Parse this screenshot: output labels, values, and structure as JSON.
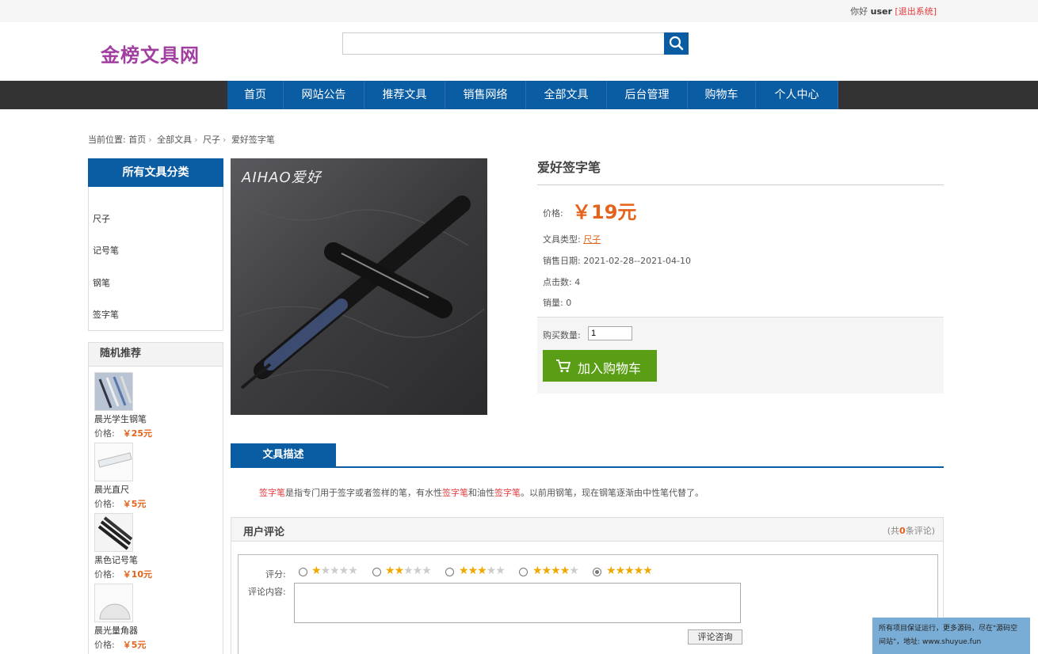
{
  "topbar": {
    "greeting": "你好",
    "username": "user",
    "logout": "[退出系统]"
  },
  "logo": "金榜文具网",
  "search": {
    "value": "",
    "placeholder": ""
  },
  "nav": [
    "首页",
    "网站公告",
    "推荐文具",
    "销售网络",
    "全部文具",
    "后台管理",
    "购物车",
    "个人中心"
  ],
  "breadcrumb": {
    "prefix": "当前位置:",
    "items": [
      "首页",
      "全部文具",
      "尺子",
      "爱好签字笔"
    ]
  },
  "categories": {
    "title": "所有文具分类",
    "items": [
      "尺子",
      "记号笔",
      "钢笔",
      "签字笔"
    ]
  },
  "recommend": {
    "title": "随机推荐",
    "price_label": "价格:",
    "items": [
      {
        "name": "晨光学生钢笔",
        "price": "￥25元"
      },
      {
        "name": "晨光直尺",
        "price": "￥5元"
      },
      {
        "name": "黑色记号笔",
        "price": "￥10元"
      },
      {
        "name": "晨光量角器",
        "price": "￥5元"
      }
    ]
  },
  "product": {
    "image_text": "AIHAO爱好",
    "title": "爱好签字笔",
    "price_label": "价格:",
    "price": "￥19元",
    "type_label": "文具类型:",
    "type": "尺子",
    "date_label": "销售日期:",
    "date": "2021-02-28--2021-04-10",
    "clicks_label": "点击数:",
    "clicks": "4",
    "sales_label": "销量:",
    "sales": "0",
    "qty_label": "购买数量:",
    "qty": "1",
    "cart_button": "加入购物车"
  },
  "description": {
    "tab": "文具描述",
    "parts": [
      "签字笔",
      "是指专门用于签字或者签样的笔，有水性",
      "签字笔",
      "和油性",
      "签字笔",
      "。以前用钢笔，现在钢笔逐渐由中性笔代替了。"
    ]
  },
  "comments": {
    "title": "用户评论",
    "count_prefix": "(共",
    "count": "0",
    "count_suffix": "条评论)",
    "score_label": "评分:",
    "scores": [
      1,
      2,
      3,
      4,
      5
    ],
    "selected_score": 5,
    "content_label": "评论内容:",
    "content_value": "",
    "submit": "评论咨询"
  },
  "promo": "所有项目保证运行，更多源码，尽在\"源码空间站\"，地址: www.shuyue.fun",
  "colors": {
    "nav_blue": "#0a5ca3",
    "price_orange": "#e4621a",
    "cart_green": "#5a9e16",
    "logo_purple": "#a03fa0"
  }
}
